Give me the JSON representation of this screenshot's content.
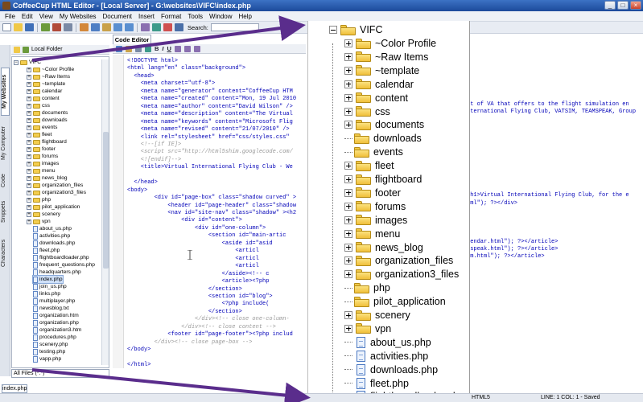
{
  "window": {
    "title": "CoffeeCup HTML Editor - [Local Server] - G:\\websites\\VIFC\\index.php",
    "buttons": [
      "_",
      "□",
      "×"
    ]
  },
  "menu": [
    "File",
    "Edit",
    "View",
    "My Websites",
    "Document",
    "Insert",
    "Format",
    "Tools",
    "Window",
    "Help"
  ],
  "toolbar": {
    "search_label": "Search:"
  },
  "vertical_tabs": [
    "My Websites",
    "My Computer",
    "Code",
    "Snippets",
    "Characters"
  ],
  "left_panel": {
    "header_label": "Local Folder",
    "root": "VIFC",
    "folders": [
      "~Color Profile",
      "~Raw Items",
      "~template",
      "calendar",
      "content",
      "css",
      "documents",
      "downloads",
      "events",
      "fleet",
      "flightboard",
      "footer",
      "forums",
      "images",
      "menu",
      "news_blog",
      "organization_files",
      "organization3_files",
      "php",
      "pilot_application",
      "scenery",
      "vpn"
    ],
    "files": [
      "about_us.php",
      "activities.php",
      "downloads.php",
      "fleet.php",
      "flightboardloader.php",
      "frequent_questions.php",
      "headquarters.php",
      "index.php",
      "join_us.php",
      "links.php",
      "multiplayer.php",
      "newsblog.txt",
      "organization.htm",
      "organization.php",
      "organization3.htm",
      "procedures.php",
      "scenery.php",
      "testing.php",
      "vapp.php"
    ],
    "selected_file": "index.php",
    "filter": "All Files (*.*)"
  },
  "editor": {
    "tab_label": "Code Editor",
    "toolbar_buttons": [
      "B",
      "I",
      "U"
    ],
    "code_lines": [
      {
        "text": "<!DOCTYPE html>",
        "kind": "tag"
      },
      {
        "text": "<html lang=\"en\" class=\"background\">",
        "kind": "tag"
      },
      {
        "text": "  <head>",
        "kind": "tag"
      },
      {
        "text": "    <meta charset=\"utf-8\">",
        "kind": "tag"
      },
      {
        "text": "    <meta name=\"generator\" content=\"CoffeeCup HTM",
        "kind": "tag"
      },
      {
        "text": "    <meta name=\"created\" content=\"Mon, 19 Jul 2010",
        "kind": "tag"
      },
      {
        "text": "    <meta name=\"author\" content=\"David Wilson\" />",
        "kind": "tag"
      },
      {
        "text": "    <meta name=\"description\" content=\"The Virtual",
        "kind": "tag"
      },
      {
        "text": "    <meta name=\"keywords\" content=\"Microsoft Flig",
        "kind": "tag"
      },
      {
        "text": "    <meta name=\"revised\" content=\"21/07/2010\" />",
        "kind": "tag"
      },
      {
        "text": "    <link rel=\"stylesheet\" href=\"css/styles.css\"",
        "kind": "tag"
      },
      {
        "text": "    <!--[if IE]>",
        "kind": "comment"
      },
      {
        "text": "    <script src=\"http://html5shim.googlecode.com/",
        "kind": "comment"
      },
      {
        "text": "    <![endif]-->",
        "kind": "comment"
      },
      {
        "text": "    <title>Virtual International Flying Club - We",
        "kind": "tag"
      },
      {
        "text": "",
        "kind": "tag"
      },
      {
        "text": "  </head>",
        "kind": "tag"
      },
      {
        "text": "<body>",
        "kind": "tag"
      },
      {
        "text": "        <div id=\"page-box\" class=\"shadow curved\" >",
        "kind": "tag"
      },
      {
        "text": "            <header id=\"page-header\" class=\"shadow",
        "kind": "tag"
      },
      {
        "text": "            <nav id=\"site-nav\" class=\"shadow\" ><h2",
        "kind": "tag"
      },
      {
        "text": "                <div id=\"content\">",
        "kind": "tag"
      },
      {
        "text": "                    <div id=\"one-column\">",
        "kind": "tag"
      },
      {
        "text": "                        <section id=\"main-artic",
        "kind": "tag"
      },
      {
        "text": "                            <aside id=\"asid",
        "kind": "tag"
      },
      {
        "text": "                                <articl",
        "kind": "tag"
      },
      {
        "text": "                                <articl",
        "kind": "tag"
      },
      {
        "text": "                                <articl",
        "kind": "tag"
      },
      {
        "text": "                            </aside><!-- c",
        "kind": "tag"
      },
      {
        "text": "                            <article><?php",
        "kind": "tag"
      },
      {
        "text": "                        </section>",
        "kind": "tag"
      },
      {
        "text": "                        <section id=\"blog\">",
        "kind": "tag"
      },
      {
        "text": "                            <?php include(",
        "kind": "tag"
      },
      {
        "text": "                        </section>",
        "kind": "tag"
      },
      {
        "text": "                    </div><!-- close one-column-",
        "kind": "comment"
      },
      {
        "text": "                </div><!-- close content -->",
        "kind": "comment"
      },
      {
        "text": "            <footer id=\"page-footer\"><?php includ",
        "kind": "tag"
      },
      {
        "text": "        </div><!-- close page-box -->",
        "kind": "comment"
      },
      {
        "text": "</body>",
        "kind": "tag"
      },
      {
        "text": "",
        "kind": "tag"
      },
      {
        "text": "</html>",
        "kind": "tag"
      }
    ],
    "right_fragments": [
      "pt of VA that offers to the flight simulation en",
      "nternational Flying Club, VATSIM, TEAMSPEAK, Group",
      "<h1>Virtual International Flying Club, for the e",
      "tml\"); ?></div>",
      "lendar.html\"); ?></article>",
      "mspeak.html\"); ?></article>",
      "um.html\"); ?></article>"
    ]
  },
  "bottom": {
    "doc_tab": "index.php",
    "encoding": "HTML5",
    "position": "LINE: 1  COL: 1 - Saved"
  },
  "zoom_tree": {
    "root": "VIFC",
    "folders": [
      "~Color Profile",
      "~Raw Items",
      "~template",
      "calendar",
      "content",
      "css",
      "documents",
      "downloads",
      "events",
      "fleet",
      "flightboard",
      "footer",
      "forums",
      "images",
      "menu",
      "news_blog",
      "organization_files",
      "organization3_files",
      "php",
      "pilot_application",
      "scenery",
      "vpn"
    ],
    "expandable": [
      true,
      true,
      true,
      true,
      true,
      true,
      true,
      false,
      false,
      true,
      true,
      true,
      true,
      true,
      true,
      true,
      true,
      true,
      false,
      false,
      true,
      true
    ],
    "files": [
      "about_us.php",
      "activities.php",
      "downloads.php",
      "fleet.php",
      "flightboardloader.php"
    ]
  },
  "colors": {
    "arrow": "#5a2d8c",
    "folder": "#f3cd4f",
    "title_bar": "#2b5bb0",
    "code_tag": "#0000b8",
    "code_comment": "#9a9a9a"
  }
}
